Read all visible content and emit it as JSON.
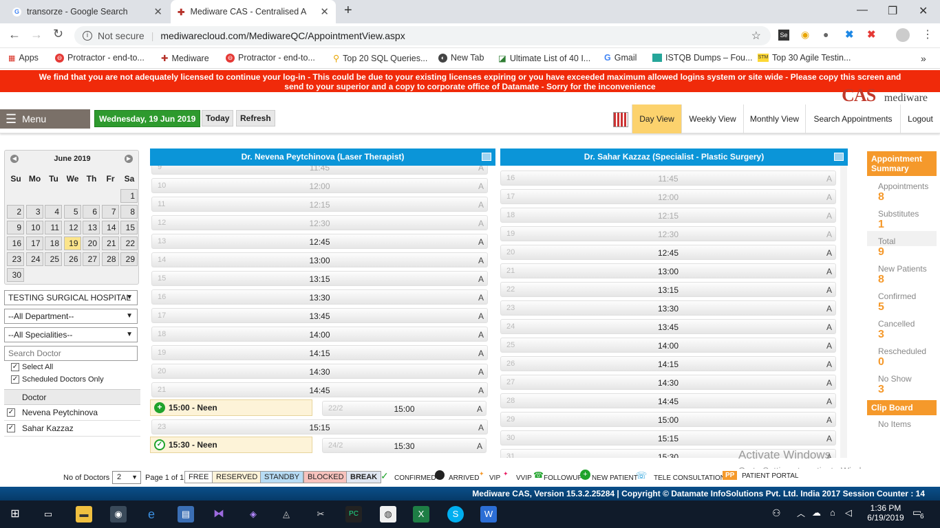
{
  "browser": {
    "tabs": [
      {
        "title": "transorze - Google Search"
      },
      {
        "title": "Mediware CAS - Centralised App"
      }
    ],
    "security": "Not secure",
    "url": "mediwarecloud.com/MediwareQC/AppointmentView.aspx",
    "bookmarks": [
      {
        "label": "Apps"
      },
      {
        "label": "Protractor - end-to..."
      },
      {
        "label": "Mediware"
      },
      {
        "label": "Protractor - end-to..."
      },
      {
        "label": "Top 20 SQL Queries..."
      },
      {
        "label": "New Tab"
      },
      {
        "label": "Ultimate List of 40 I..."
      },
      {
        "label": "Gmail"
      },
      {
        "label": "ISTQB Dumps – Fou..."
      },
      {
        "label": "Top 30 Agile Testin..."
      }
    ]
  },
  "warning": {
    "line1": "We find that you are not adequately licensed to continue your log-in - This could be due to your existing licenses expiring or you have exceeded maximum allowed logins system or site wide - Please copy this screen and",
    "line2": "send to your superior and a copy to corporate office of Datamate - Sorry for the inconvenience"
  },
  "nav": {
    "menu": "Menu",
    "date": "Wednesday, 19 Jun 2019",
    "today": "Today",
    "refresh": "Refresh",
    "views": [
      "Day View",
      "Weekly View",
      "Monthly View",
      "Search Appointments",
      "Logout"
    ]
  },
  "calendar": {
    "title": "June 2019",
    "dow": [
      "Su",
      "Mo",
      "Tu",
      "We",
      "Th",
      "Fr",
      "Sa"
    ],
    "selected_day": "19"
  },
  "filters": {
    "hospital": "TESTING SURGICAL HOSPITAL",
    "department": "--All Department--",
    "speciality": "--All Specialities--",
    "search_placeholder": "Search Doctor",
    "select_all": "Select All",
    "scheduled_only": "Scheduled Doctors Only",
    "doctor_header": "Doctor",
    "doctors": [
      "Nevena Peytchinova",
      "Sahar Kazzaz"
    ]
  },
  "columns": [
    {
      "title": "Dr. Nevena Peytchinova (Laser Therapist)",
      "slots": [
        {
          "n": "9",
          "t": "11:45",
          "a": "A",
          "dim": true
        },
        {
          "n": "10",
          "t": "12:00",
          "a": "A",
          "dim": true
        },
        {
          "n": "11",
          "t": "12:15",
          "a": "A",
          "dim": true
        },
        {
          "n": "12",
          "t": "12:30",
          "a": "A",
          "dim": true
        },
        {
          "n": "13",
          "t": "12:45",
          "a": "A",
          "dim": false
        },
        {
          "n": "14",
          "t": "13:00",
          "a": "A",
          "dim": false
        },
        {
          "n": "15",
          "t": "13:15",
          "a": "A",
          "dim": false
        },
        {
          "n": "16",
          "t": "13:30",
          "a": "A",
          "dim": false
        },
        {
          "n": "17",
          "t": "13:45",
          "a": "A",
          "dim": false
        },
        {
          "n": "18",
          "t": "14:00",
          "a": "A",
          "dim": false
        },
        {
          "n": "19",
          "t": "14:15",
          "a": "A",
          "dim": false
        },
        {
          "n": "20",
          "t": "14:30",
          "a": "A",
          "dim": false
        },
        {
          "n": "21",
          "t": "14:45",
          "a": "A",
          "dim": false
        }
      ],
      "appointments": [
        {
          "label": "15:00 - Neen",
          "n": "22/2",
          "t": "15:00",
          "a": "A",
          "icon": "plus"
        },
        {
          "label": "",
          "n": "23",
          "t": "15:15",
          "a": "A",
          "icon": ""
        },
        {
          "label": "15:30 - Neen",
          "n": "24/2",
          "t": "15:30",
          "a": "A",
          "icon": "check"
        }
      ]
    },
    {
      "title": "Dr. Sahar Kazzaz (Specialist - Plastic Surgery)",
      "slots": [
        {
          "n": "16",
          "t": "11:45",
          "a": "A",
          "dim": true
        },
        {
          "n": "17",
          "t": "12:00",
          "a": "A",
          "dim": true
        },
        {
          "n": "18",
          "t": "12:15",
          "a": "A",
          "dim": true
        },
        {
          "n": "19",
          "t": "12:30",
          "a": "A",
          "dim": true
        },
        {
          "n": "20",
          "t": "12:45",
          "a": "A",
          "dim": false
        },
        {
          "n": "21",
          "t": "13:00",
          "a": "A",
          "dim": false
        },
        {
          "n": "22",
          "t": "13:15",
          "a": "A",
          "dim": false
        },
        {
          "n": "23",
          "t": "13:30",
          "a": "A",
          "dim": false
        },
        {
          "n": "24",
          "t": "13:45",
          "a": "A",
          "dim": false
        },
        {
          "n": "25",
          "t": "14:00",
          "a": "A",
          "dim": false
        },
        {
          "n": "26",
          "t": "14:15",
          "a": "A",
          "dim": false
        },
        {
          "n": "27",
          "t": "14:30",
          "a": "A",
          "dim": false
        },
        {
          "n": "28",
          "t": "14:45",
          "a": "A",
          "dim": false
        },
        {
          "n": "29",
          "t": "15:00",
          "a": "A",
          "dim": false
        },
        {
          "n": "30",
          "t": "15:15",
          "a": "A",
          "dim": false
        },
        {
          "n": "31",
          "t": "15:30",
          "a": "A",
          "dim": false
        }
      ]
    }
  ],
  "summary": {
    "title": "Appointment Summary",
    "items": [
      {
        "label": "Appointments",
        "value": "8"
      },
      {
        "label": "Substitutes",
        "value": "1"
      },
      {
        "label": "Total",
        "value": "9"
      },
      {
        "label": "New Patients",
        "value": "8"
      },
      {
        "label": "Confirmed",
        "value": "5"
      },
      {
        "label": "Cancelled",
        "value": "3"
      },
      {
        "label": "Rescheduled",
        "value": "0"
      },
      {
        "label": "No Show",
        "value": "3"
      }
    ],
    "clipboard_title": "Clip Board",
    "clipboard_empty": "No Items"
  },
  "footer": {
    "no_of_doctors_label": "No of Doctors",
    "no_of_doctors": "2",
    "page": "Page 1 of 1",
    "legend": [
      "FREE",
      "RESERVED",
      "STANDBY",
      "BLOCKED",
      "BREAK",
      "CONFIRMED",
      "ARRIVED",
      "VIP",
      "VVIP",
      "FOLLOWUP",
      "NEW PATIENT",
      "TELE CONSULTATION",
      "PATIENT PORTAL"
    ],
    "pp_badge": "PP",
    "copyright": "Mediware CAS, Version 15.3.2.25284 | Copyright © Datamate InfoSolutions Pvt. Ltd. India 2017 Session Counter : 14"
  },
  "watermark": {
    "line1": "Activate Windows",
    "line2": "Go to Settings to activate Windows."
  },
  "taskbar": {
    "time": "1:36 PM",
    "date": "6/19/2019",
    "notifications": "6"
  },
  "colors": {
    "warning": "#f02a0a",
    "header": "#0b95d8",
    "accent": "#f5992b",
    "date_green": "#2e9a2e",
    "day_view": "#fcd26d"
  }
}
